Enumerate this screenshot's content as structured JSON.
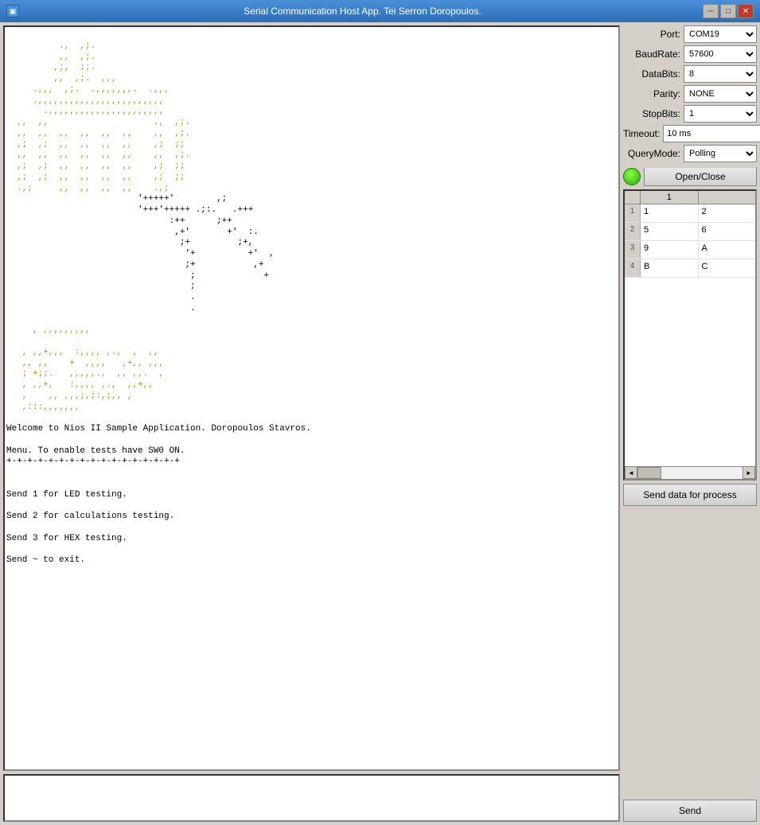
{
  "window": {
    "title": "Serial Communication Host App. Tei Serron Doropoulos."
  },
  "titlebar": {
    "minimize_label": "─",
    "maximize_label": "□",
    "close_label": "✕"
  },
  "settings": {
    "port_label": "Port:",
    "baudrate_label": "BaudRate:",
    "databits_label": "DataBits:",
    "parity_label": "Parity:",
    "stopbits_label": "StopBits:",
    "timeout_label": "Timeout:",
    "querymode_label": "QueryMode:",
    "port_value": "COM19",
    "baudrate_value": "57600",
    "databits_value": "8",
    "parity_value": "NONE",
    "stopbits_value": "1",
    "timeout_value": "10 ms",
    "querymode_value": "Polling",
    "open_close_label": "Open/Close"
  },
  "table": {
    "header": "1",
    "rows": [
      {
        "row_num": "1",
        "col1": "1",
        "col2": "2"
      },
      {
        "row_num": "2",
        "col1": "5",
        "col2": "6"
      },
      {
        "row_num": "3",
        "col1": "9",
        "col2": "A"
      },
      {
        "row_num": "4",
        "col1": "B",
        "col2": "C"
      }
    ]
  },
  "send_data_btn_label": "Send data for process",
  "send_btn_label": "Send",
  "terminal": {
    "ascii_art": "          .,  ,;.\n          ,,  ,;.\n         ,;,  ;;.\n         ,,  ,;.  ,,,\n      ,,,,   ..,,,,,,,,.  .,,,\n      .,,,,,,,,,,,,,,,,,,,,,,\n        .,,,,,,,,,,,,,,,,,,,,\n '++++'       .   .+++\n '+++'+++++ .;:    .+++\n       :++        ;++\n        ,+'        +'  :.\n        ;+          ;+,\n        '+           +'  ,\n        ;+            ,+\n         ;             +\n         ;\n\n         .,,,,,,,,,\n\n     , ,,+,,,  :,,,, ,.,  ,  ,,\n     ,, ,,    +  ,,,,   ,+,, ,,,\n     ; +;;.   ,,,,,.,  ,, ,,.  ,\n     , ,,+,   :,,,, ,.,  ,,+,,\n     ,    ,, ,,,;,;:,;,, ,\n     ,:::,,,,,,,",
    "welcome_text": "Welcome to Nios II Sample Application. Doropoulos Stavros.",
    "menu_line": "Menu. To enable tests have SW0 ON.",
    "separator": "+-+-+-+-+-+-+-+-+-+-+-+-+-+-+-+-+",
    "option1": "Send 1 for LED testing.",
    "option2": "Send 2 for calculations testing.",
    "option3": "Send 3 for HEX testing.",
    "option4": "Send ~ to exit."
  }
}
